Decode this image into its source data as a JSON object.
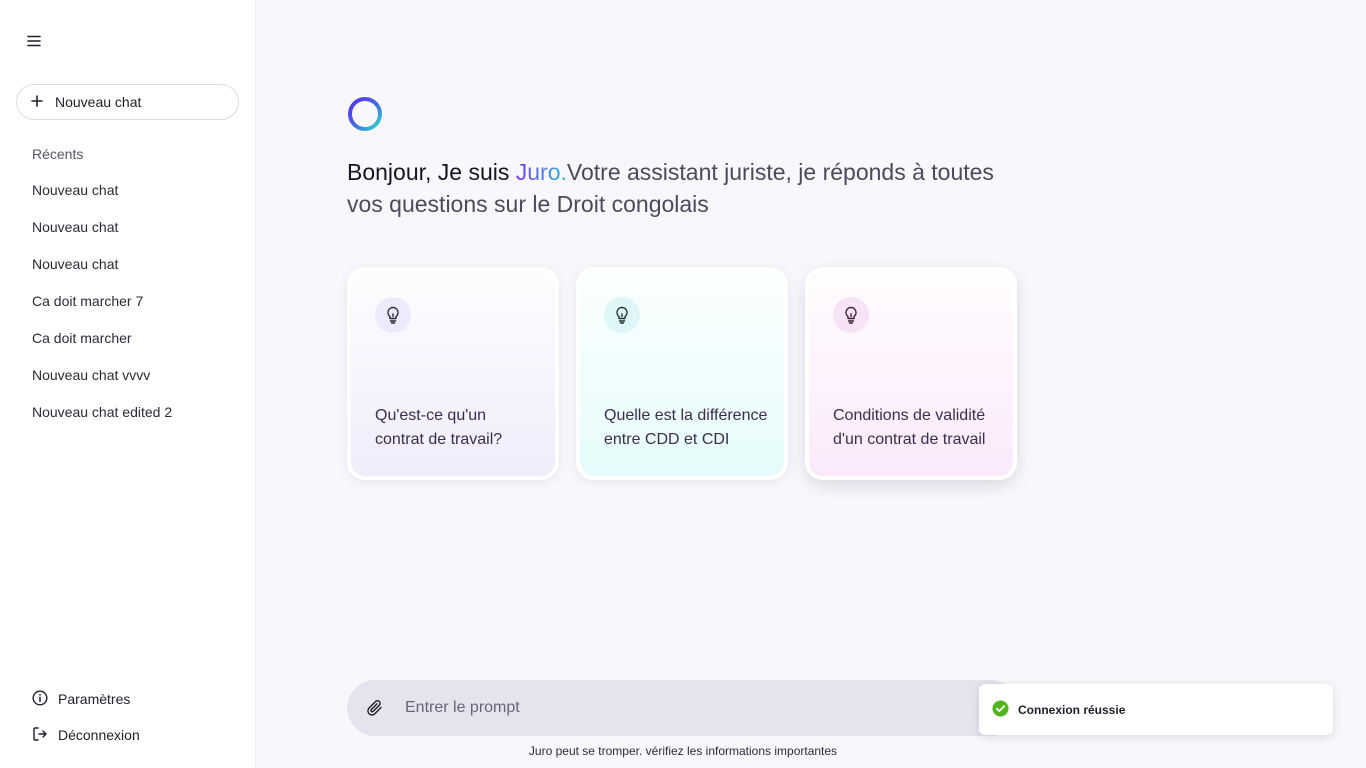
{
  "sidebar": {
    "menu_icon": "hamburger-menu-icon",
    "new_chat_label": "Nouveau chat",
    "recents_title": "Récents",
    "chats": [
      "Nouveau chat",
      "Nouveau chat",
      "Nouveau chat",
      "Ca doit marcher 7",
      "Ca doit marcher",
      "Nouveau chat vvvv",
      "Nouveau chat edited 2"
    ],
    "settings_label": "Paramètres",
    "logout_label": "Déconnexion"
  },
  "main": {
    "greeting_lead": "Bonjour, Je suis ",
    "greeting_brand": "Juro.",
    "greeting_rest": "Votre assistant juriste, je réponds à toutes vos questions sur le Droit congolais",
    "cards": [
      {
        "text": "Qu'est-ce qu'un contrat de travail?",
        "icon": "lightbulb-icon"
      },
      {
        "text": "Quelle est la différence entre CDD et CDI",
        "icon": "lightbulb-icon"
      },
      {
        "text": "Conditions de validité d'un contrat de travail",
        "icon": "lightbulb-icon"
      }
    ],
    "prompt_placeholder": "Entrer le prompt",
    "disclaimer": "Juro peut se tromper. vérifiez les informations importantes"
  },
  "toast": {
    "message": "Connexion réussie",
    "status_color": "#52b31f"
  },
  "colors": {
    "brand_gradient_start": "#7b3cf0",
    "brand_gradient_end": "#2fb7d8"
  }
}
